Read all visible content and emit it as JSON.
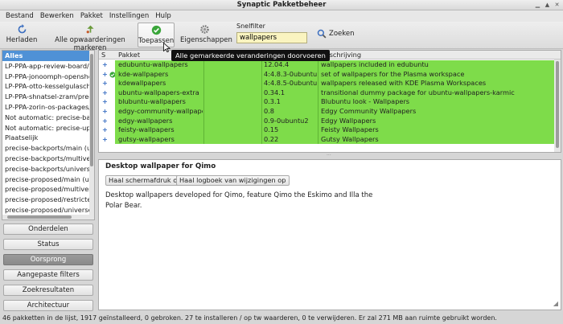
{
  "window": {
    "title": "Synaptic Pakketbeheer"
  },
  "menu": [
    "Bestand",
    "Bewerken",
    "Pakket",
    "Instellingen",
    "Hulp"
  ],
  "toolbar": {
    "reload": "Herladen",
    "mark_all": "Alle opwaarderingen markeren",
    "apply": "Toepassen",
    "properties": "Eigenschappen",
    "quickfilter_label": "Snelfilter",
    "quickfilter_value": "wallpapers",
    "search": "Zoeken"
  },
  "tooltip": "Alle gemarkeerde veranderingen doorvoeren",
  "sidebar": {
    "items": [
      "Alles",
      "LP-PPA-app-review-board/pr",
      "LP-PPA-jonoomph-openshot",
      "LP-PPA-otto-kesselgulasch-g",
      "LP-PPA-shnatsel-zram/precis",
      "LP-PPA-zorin-os-packages/pr",
      "Not automatic: precise-back",
      "Not automatic: precise-upda",
      "Plaatselijk",
      "precise-backports/main (us.a",
      "precise-backports/multivers",
      "precise-backports/universe (",
      "precise-proposed/main (ubu",
      "precise-proposed/multivers",
      "precise-proposed/restricted",
      "precise-proposed/universe ("
    ],
    "buttons": [
      "Onderdelen",
      "Status",
      "Oorsprong",
      "Aangepaste filters",
      "Zoekresultaten",
      "Architectuur"
    ]
  },
  "packages": {
    "columns": {
      "s": "S",
      "package": "Pakket",
      "version": "",
      "description": "Beschrijving"
    },
    "rows": [
      {
        "status": "+",
        "name": "edubuntu-wallpapers",
        "version": "12.04.4",
        "description": "wallpapers included in edubuntu"
      },
      {
        "status": "+",
        "name": "kde-wallpapers",
        "version": "4:4.8.3-0ubuntu0.1",
        "description": "set of wallpapers for the Plasma workspace"
      },
      {
        "status": "+",
        "name": "kdewallpapers",
        "version": "4:4.8.5-0ubuntu0.1",
        "description": "wallpapers released with KDE Plasma Workspaces"
      },
      {
        "status": "+",
        "name": "ubuntu-wallpapers-extra",
        "version": "0.34.1",
        "description": "transitional dummy package for ubuntu-wallpapers-karmic"
      },
      {
        "status": "+",
        "name": "blubuntu-wallpapers",
        "version": "0.3.1",
        "description": "Blubuntu look - Wallpapers"
      },
      {
        "status": "+",
        "name": "edgy-community-wallpapers",
        "version": "0.8",
        "description": "Edgy Community Wallpapers"
      },
      {
        "status": "+",
        "name": "edgy-wallpapers",
        "version": "0.9-0ubuntu2",
        "description": "Edgy Wallpapers"
      },
      {
        "status": "+",
        "name": "feisty-wallpapers",
        "version": "0.15",
        "description": "Feisty Wallpapers"
      },
      {
        "status": "+",
        "name": "gutsy-wallpapers",
        "version": "0.22",
        "description": "Gutsy Wallpapers"
      }
    ]
  },
  "details": {
    "title": "Desktop wallpaper for Qimo",
    "screenshot_btn": "Haal schermafdruk op",
    "changelog_btn": "Haal logboek van wijzigingen op",
    "text_line1": "Desktop wallpapers developed for Qimo, feature Qimo the Eskimo and Illa the",
    "text_line2": "Polar Bear."
  },
  "status": "46 pakketten in de lijst, 1917 geïnstalleerd, 0 gebroken. 27 te installeren / op tw waarderen, 0 te verwijderen. Er zal 271 MB aan ruimte gebruikt worden.",
  "colors": {
    "selection": "#4f91d6",
    "marked_row": "#7edc4a",
    "filter_bg": "#faf4c0"
  }
}
